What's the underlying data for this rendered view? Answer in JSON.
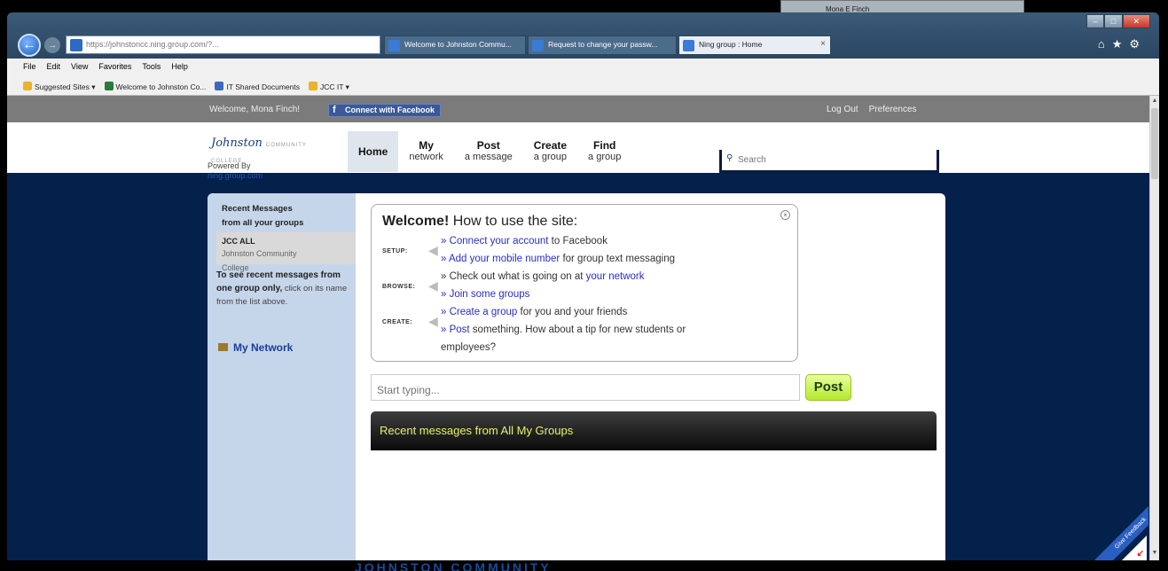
{
  "browser": {
    "ghost_window_title": "Mona E Finch",
    "address": "https://johnstoncc.ning.group.com/?...",
    "tabs": [
      {
        "label": "Welcome to Johnston Commu...",
        "active": false
      },
      {
        "label": "Request to change your passw...",
        "active": false
      },
      {
        "label": "Ning group : Home",
        "active": true
      }
    ],
    "menu": [
      "File",
      "Edit",
      "View",
      "Favorites",
      "Tools",
      "Help"
    ],
    "favorites": [
      "Suggested Sites ▾",
      "Welcome to Johnston Co...",
      "IT Shared Documents",
      "JCC IT ▾"
    ],
    "icons": [
      "home-icon",
      "star-icon",
      "gear-icon"
    ]
  },
  "topbar": {
    "welcome": "Welcome, Mona Finch!",
    "facebook_button": "Connect with Facebook",
    "logout": "Log Out",
    "preferences": "Preferences"
  },
  "header": {
    "logo_script": "Johnston",
    "logo_small": "COMMUNITY COLLEGE",
    "powered_by": "Powered By",
    "powered_link": "ning.group.com",
    "nav": {
      "home": "Home",
      "my_network": {
        "top": "My",
        "bottom": "network"
      },
      "post_message": {
        "top": "Post",
        "bottom": "a message"
      },
      "create_group": {
        "top": "Create",
        "bottom": "a group"
      },
      "find_group": {
        "top": "Find",
        "bottom": "a group"
      }
    },
    "search_placeholder": "Search"
  },
  "sidebar": {
    "heading_1": "Recent Messages",
    "heading_2": "from all your groups",
    "group_name": "JCC ALL",
    "group_sub": "Johnston Community",
    "group_sub2": "College",
    "info_bold_1": "To see recent messages from",
    "info_bold_2": "one group only,",
    "info_text": "click on its name from the list above.",
    "my_network": "My Network"
  },
  "welcome_box": {
    "title_bold": "Welcome!",
    "title_rest": " How to use the site:",
    "labels": {
      "setup": "SETUP:",
      "browse": "BROWSE:",
      "create": "CREATE:"
    },
    "lines": {
      "l1_link": "» Connect your account",
      "l1_text": " to Facebook",
      "l2_link": "» Add your mobile number",
      "l2_text": " for group text messaging",
      "l3_text": "» Check out what is going on at ",
      "l3_link": "your network",
      "l4_link": "» Join some groups",
      "l5_link": "» Create a group",
      "l5_text": " for you and your friends",
      "l6_link": "» Post",
      "l6_text": " something. How about a tip for new students or",
      "l7_text": "employees?"
    }
  },
  "composer": {
    "placeholder": "Start typing...",
    "post_button": "Post"
  },
  "recent": {
    "title": "Recent messages from All My Groups"
  },
  "feedback": {
    "ribbon": "Give Feedback"
  },
  "bottom_text": "JOHNSTON COMMUNITY",
  "colors": {
    "page_bg": "#04214b",
    "topbar": "#7b7b7b",
    "sidebar": "#c6d6ea",
    "link": "#2a2fbf",
    "post_button": "#b5ea2c",
    "recent_title": "#e8f06a"
  }
}
